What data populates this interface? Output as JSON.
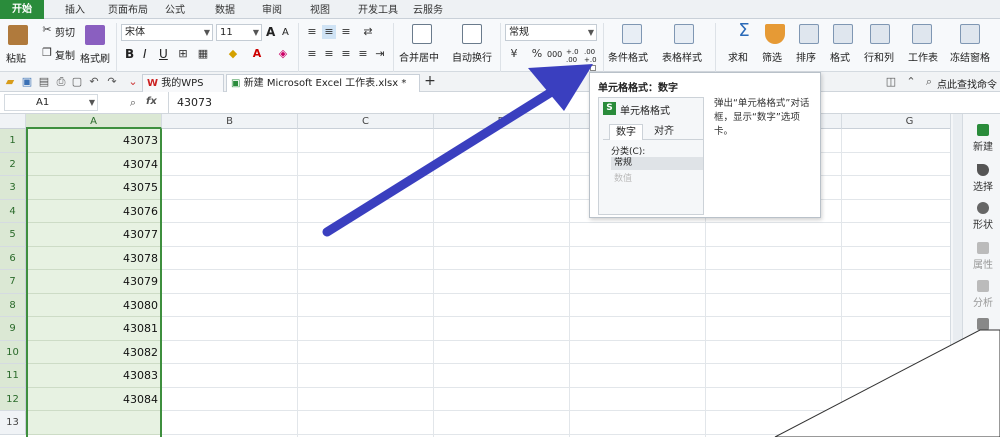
{
  "ribbon_tabs": [
    "开始",
    "插入",
    "页面布局",
    "公式",
    "数据",
    "审阅",
    "视图",
    "开发工具",
    "云服务"
  ],
  "clipboard": {
    "paste": "粘贴",
    "cut": "剪切",
    "copy": "复制",
    "format_painter": "格式刷"
  },
  "font": {
    "name": "宋体",
    "size": "11",
    "bold": "B",
    "italic": "I",
    "underline": "U",
    "grow": "A",
    "shrink": "A"
  },
  "align": {
    "merge": "合并居中",
    "wrap": "自动换行"
  },
  "number": {
    "format": "常规",
    "currency": "¥",
    "percent": "%",
    "thousands": "000",
    "inc_decimal": "+.0 .00",
    "dec_decimal": ".00 +.0"
  },
  "styles": {
    "conditional": "条件格式",
    "table_style": "表格样式"
  },
  "editing": {
    "sum": "求和",
    "filter": "筛选",
    "sort": "排序",
    "format": "格式",
    "rowcol": "行和列",
    "sheet": "工作表",
    "freeze": "冻结窗格"
  },
  "quickbar": {
    "mywps": "我的WPS",
    "doc_tab": "新建 Microsoft Excel 工作表.xlsx *",
    "find_cmd": "点此查找命令",
    "add_tab": "+",
    "close": "×"
  },
  "formula_bar": {
    "name_box": "A1",
    "fx": "fx",
    "value": "43073"
  },
  "columns": [
    "A",
    "B",
    "C",
    "D",
    "E",
    "F",
    "G"
  ],
  "rows": [
    "1",
    "2",
    "3",
    "4",
    "5",
    "6",
    "7",
    "8",
    "9",
    "10",
    "11",
    "12",
    "13"
  ],
  "cells": [
    "43073",
    "43074",
    "43075",
    "43076",
    "43077",
    "43078",
    "43079",
    "43080",
    "43081",
    "43082",
    "43083",
    "43084",
    ""
  ],
  "side_panel": [
    "新建",
    "选择",
    "形状",
    "属性",
    "分析"
  ],
  "tooltip": {
    "title": "单元格格式：数字",
    "dialog_title": "单元格格式",
    "tab_number": "数字",
    "tab_align": "对齐",
    "category_label": "分类(C):",
    "item_normal": "常规",
    "item_numeric": "数值",
    "description": "弹出“单元格格式”对话框，显示“数字”选项卡。"
  },
  "colors": {
    "accent_green": "#2a8c3b",
    "arrow": "#3a3fbf",
    "selection": "#e7f2e2"
  }
}
